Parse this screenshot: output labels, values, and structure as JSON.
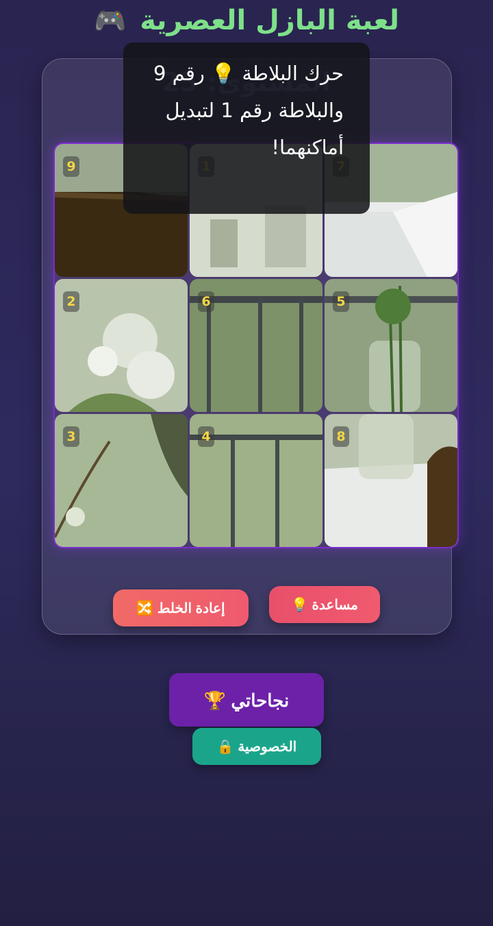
{
  "title": "لعبة البازل العصرية",
  "title_icon": "🎮",
  "level_text": "المستوى: 25",
  "tooltip": "حرك البلاطة 💡 رقم 9 والبلاطة رقم 1 لتبديل أماكنهما!",
  "tiles": [
    {
      "number": "9",
      "scene": "dark-table-corner"
    },
    {
      "number": "1",
      "scene": "window-blinds"
    },
    {
      "number": "7",
      "scene": "window-sill"
    },
    {
      "number": "2",
      "scene": "white-flowers"
    },
    {
      "number": "6",
      "scene": "balcony-railing"
    },
    {
      "number": "5",
      "scene": "vase-stems"
    },
    {
      "number": "3",
      "scene": "tree-branch"
    },
    {
      "number": "4",
      "scene": "railing-bottom"
    },
    {
      "number": "8",
      "scene": "vase-base-table"
    }
  ],
  "buttons": {
    "help": "مساعدة 💡",
    "shuffle": "إعادة الخلط 🔀",
    "achievements": "نجاحاتي 🏆",
    "privacy": "الخصوصية 🔒"
  },
  "colors": {
    "title": "#7ee08a",
    "board_border": "#7b2ccf",
    "help_button": "#e8506a",
    "shuffle_button": "#f06a66",
    "achievements_button": "#6c21a8",
    "privacy_button": "#1aa58a",
    "tile_number": "#f2d645"
  }
}
